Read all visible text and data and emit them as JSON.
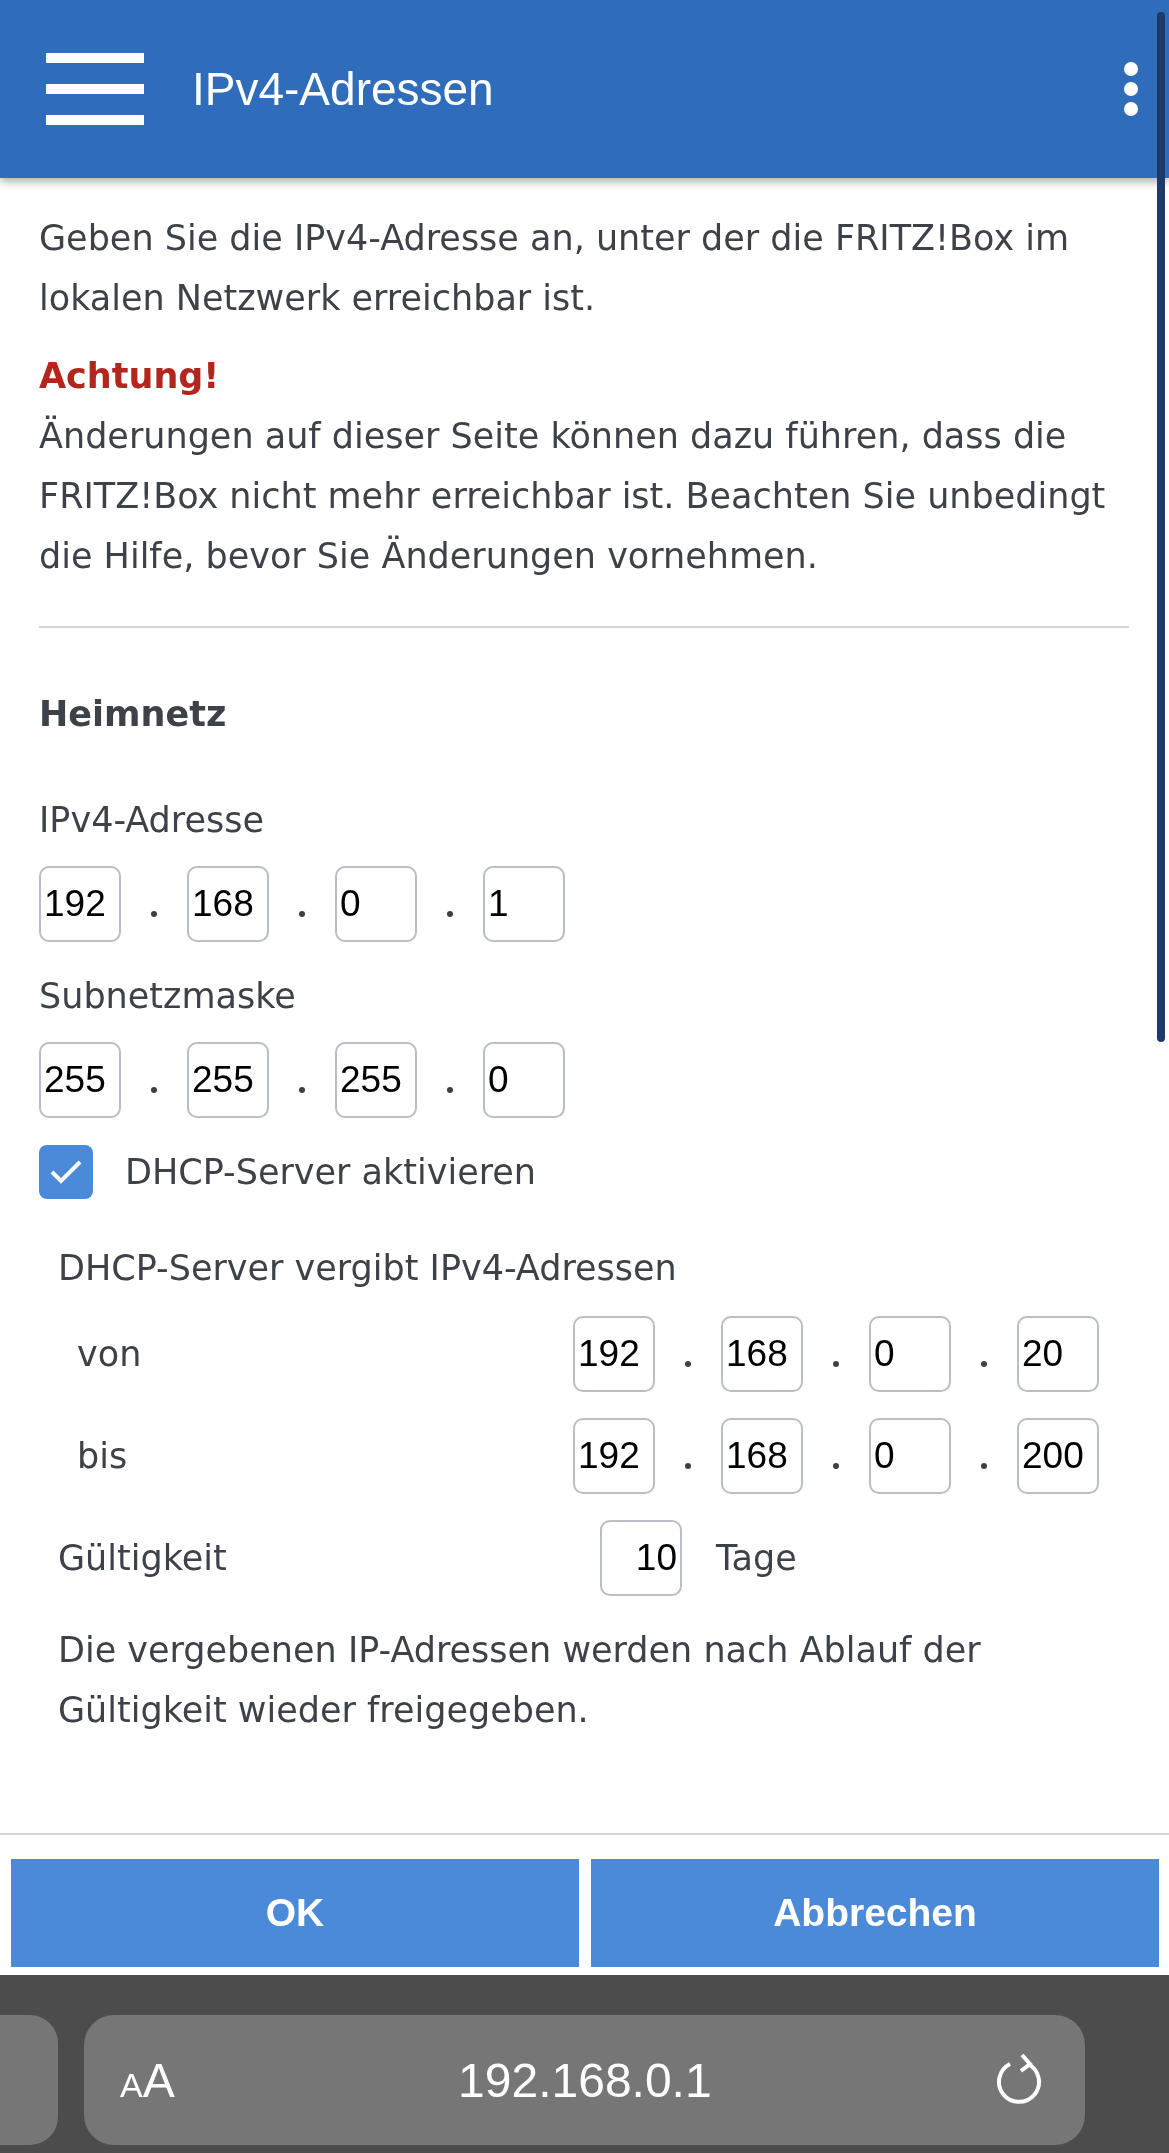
{
  "header": {
    "title": "IPv4-Adressen"
  },
  "intro": "Geben Sie die IPv4-Adresse an, unter der die FRITZ!Box im lokalen Netzwerk erreichbar ist.",
  "warning": {
    "title": "Achtung!",
    "text": "Änderungen auf dieser Seite können dazu führen, dass die FRITZ!Box nicht mehr erreichbar ist. Beachten Sie unbedingt die Hilfe, bevor Sie Änderungen vornehmen."
  },
  "section": {
    "title": "Heimnetz"
  },
  "ipv4": {
    "label": "IPv4-Adresse",
    "octets": [
      "192",
      "168",
      "0",
      "1"
    ]
  },
  "subnet": {
    "label": "Subnetzmaske",
    "octets": [
      "255",
      "255",
      "255",
      "0"
    ]
  },
  "dhcp": {
    "label": "DHCP-Server aktivieren",
    "checked": true,
    "heading": "DHCP-Server vergibt IPv4-Adressen",
    "ranges": [
      {
        "label": "von",
        "octets": [
          "192",
          "168",
          "0",
          "20"
        ]
      },
      {
        "label": "bis",
        "octets": [
          "192",
          "168",
          "0",
          "200"
        ]
      }
    ],
    "lease": {
      "label": "Gültigkeit",
      "value": "10",
      "unit": "Tage"
    },
    "note": "Die vergebenen IP-Adressen werden nach Ablauf der Gültigkeit wieder freigegeben."
  },
  "buttons": [
    {
      "label": "OK"
    },
    {
      "label": "Abbrechen"
    }
  ],
  "browser": {
    "text_size": "AA",
    "url": "192.168.0.1"
  }
}
